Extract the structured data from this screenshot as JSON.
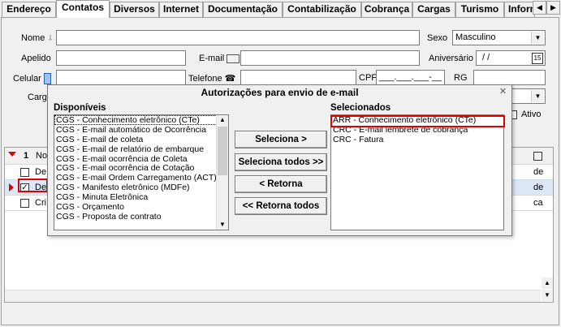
{
  "tabs": [
    "Endereço",
    "Contatos",
    "Diversos",
    "Internet",
    "Documentação",
    "Contabilização",
    "Cobrança",
    "Cargas",
    "Turismo",
    "Inform"
  ],
  "active_tab": "Contatos",
  "form": {
    "nome_label": "Nome",
    "apelido_label": "Apelido",
    "email_label": "E-mail",
    "celular_label": "Celular",
    "telefone_label": "Telefone",
    "cpf_label": "CPF",
    "cpf_mask": "___.___.___-__",
    "rg_label": "RG",
    "cargo_label": "Carg",
    "sexo_label": "Sexo",
    "sexo_value": "Masculino",
    "aniversario_label": "Aniversário",
    "aniversario_value": "/ /",
    "ativo_label": "Ativo"
  },
  "grid": {
    "header_col1": "No",
    "rows": [
      {
        "name": "De",
        "right": "de",
        "checked": false
      },
      {
        "name": "De",
        "right": "de",
        "checked": true
      },
      {
        "name": "Cri",
        "right": "ca",
        "checked": false
      }
    ],
    "count_label": "1"
  },
  "dialog": {
    "title": "Autorizações para envio de e-mail",
    "left_header": "Disponíveis",
    "right_header": "Selecionados",
    "available": [
      "CGS - Conhecimento eletrônico (CTe)",
      "CGS - E-mail automático de Ocorrência",
      "CGS - E-mail de coleta",
      "CGS - E-mail de relatório de embarque",
      "CGS - E-mail ocorrência de Coleta",
      "CGS - E-mail ocorrência de Cotação",
      "CGS - E-mail Ordem Carregamento (ACT)",
      "CGS - Manifesto eletrônico (MDFe)",
      "CGS - Minuta Eletrônica",
      "CGS - Orçamento",
      "CGS - Proposta de contrato"
    ],
    "selected": [
      "ARR - Conhecimento eletrônico (CTe)",
      "CRC - E-mail lembrete de cobrança",
      "CRC - Fatura"
    ],
    "buttons": {
      "seleciona": "Seleciona >",
      "seleciona_todos": "Seleciona todos >>",
      "retorna": "< Retorna",
      "retorna_todos": "<< Retorna todos"
    }
  },
  "colors": {
    "highlight": "#e00000",
    "selected_row": "#dce8f8",
    "accent_marker": "#e00000"
  }
}
